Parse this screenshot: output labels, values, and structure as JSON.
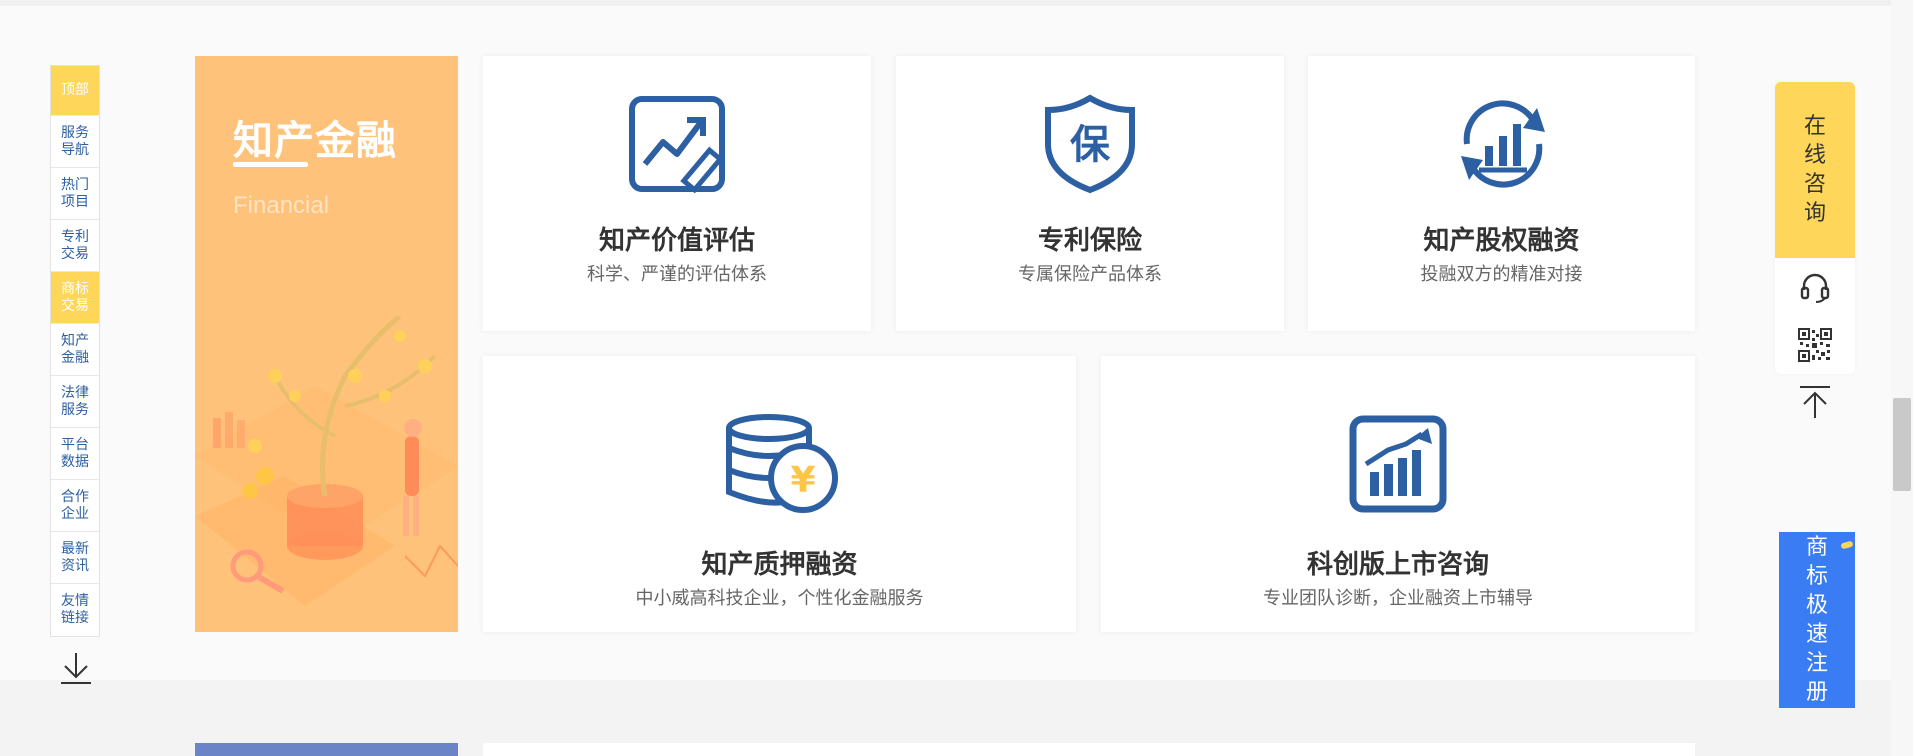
{
  "left_nav": {
    "items": [
      {
        "label": "顶部",
        "state": "top"
      },
      {
        "label": "服务导航",
        "state": ""
      },
      {
        "label": "热门项目",
        "state": ""
      },
      {
        "label": "专利交易",
        "state": ""
      },
      {
        "label": "商标交易",
        "state": "active"
      },
      {
        "label": "知产金融",
        "state": ""
      },
      {
        "label": "法律服务",
        "state": ""
      },
      {
        "label": "平台数据",
        "state": ""
      },
      {
        "label": "合作企业",
        "state": ""
      },
      {
        "label": "最新资讯",
        "state": ""
      },
      {
        "label": "友情链接",
        "state": ""
      }
    ]
  },
  "banner": {
    "title": "知产金融",
    "subtitle": "Financial"
  },
  "cards": [
    {
      "title": "知产价值评估",
      "desc": "科学、严谨的评估体系",
      "icon": "chart-edit-icon"
    },
    {
      "title": "专利保险",
      "desc": "专属保险产品体系",
      "icon": "shield-icon",
      "icon_text": "保"
    },
    {
      "title": "知产股权融资",
      "desc": "投融双方的精准对接",
      "icon": "cycle-chart-icon"
    },
    {
      "title": "知产质押融资",
      "desc": "中小威高科技企业，个性化金融服务",
      "icon": "coins-icon",
      "icon_text": "¥"
    },
    {
      "title": "科创版上市咨询",
      "desc": "专业团队诊断，企业融资上市辅导",
      "icon": "growth-chart-icon"
    }
  ],
  "right_widget": {
    "consult_chars": [
      "在",
      "线",
      "咨",
      "询"
    ],
    "register_chars": [
      "商",
      "标",
      "极",
      "速",
      "注",
      "册"
    ]
  },
  "colors": {
    "accent_yellow": "#fed659",
    "banner_orange": "#ffc27a",
    "icon_blue": "#2d5fa3",
    "nav_text_blue": "#2d5fa3",
    "register_blue": "#3a7cf3"
  }
}
